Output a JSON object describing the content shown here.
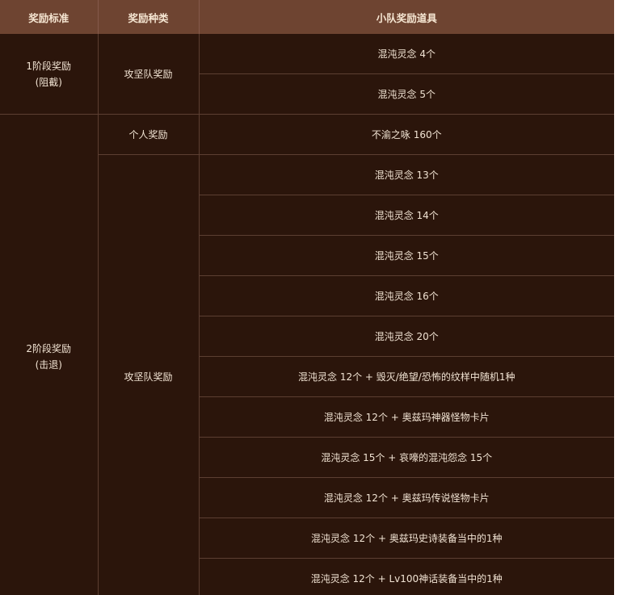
{
  "header": {
    "col1": "奖励标准",
    "col2": "奖励种类",
    "col3": "小队奖励道具"
  },
  "stage1": {
    "label_line1": "1阶段奖励",
    "label_line2": "(阻截)",
    "type": "攻坚队奖励",
    "items": [
      "混沌灵念 4个",
      "混沌灵念 5个"
    ]
  },
  "stage2": {
    "label_line1": "2阶段奖励",
    "label_line2": "(击退)",
    "personal_type": "个人奖励",
    "personal_item": "不渝之咏 160个",
    "team_type": "攻坚队奖励",
    "items": [
      "混沌灵念 13个",
      "混沌灵念 14个",
      "混沌灵念 15个",
      "混沌灵念 16个",
      "混沌灵念 20个",
      "混沌灵念 12个 + 毁灭/绝望/恐怖的纹样中随机1种",
      "混沌灵念 12个 + 奥兹玛神器怪物卡片",
      "混沌灵念 15个 + 哀嚎的混沌怨念 15个",
      "混沌灵念 12个 + 奥兹玛传说怪物卡片",
      "混沌灵念 12个 + 奥兹玛史诗装备当中的1种",
      "混沌灵念 12个 + Lv100神话装备当中的1种"
    ]
  }
}
